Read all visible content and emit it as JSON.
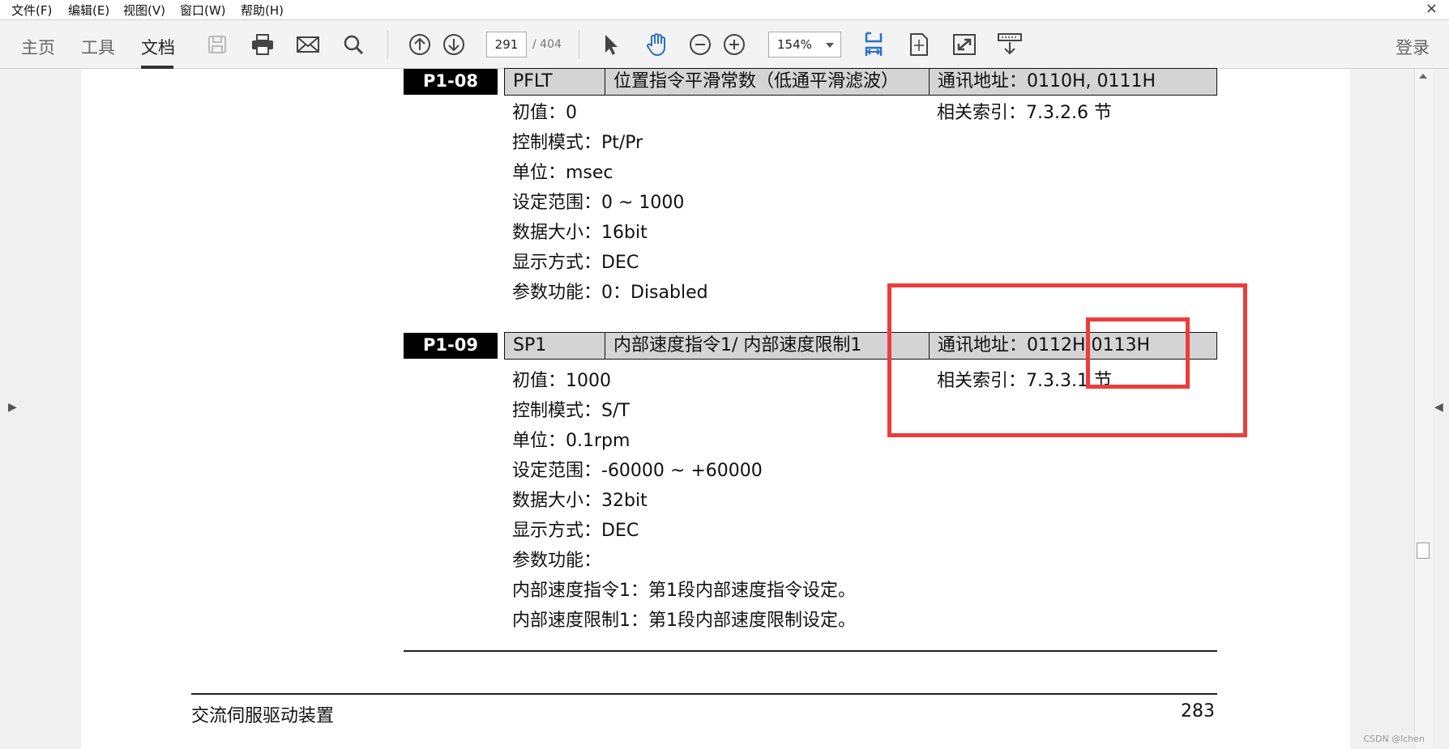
{
  "menu": {
    "items": [
      "文件(F)",
      "编辑(E)",
      "视图(V)",
      "窗口(W)",
      "帮助(H)"
    ],
    "close_glyph": "×"
  },
  "toolbar": {
    "tabs": [
      "主页",
      "工具",
      "文档"
    ],
    "active_tab": "文档",
    "icons": [
      "save-icon",
      "print-icon",
      "mail-icon",
      "search-icon",
      "prev-page-icon",
      "next-page-icon",
      "select-cursor-icon",
      "hand-tool-icon",
      "zoom-out-icon",
      "zoom-in-icon",
      "fit-width-icon",
      "fit-page-icon",
      "fullscreen-icon",
      "read-mode-icon"
    ],
    "page_current": "291",
    "page_total": "/ 404",
    "zoom": "154%",
    "login": "登录"
  },
  "doc": {
    "p1_08": {
      "id": "P1-08",
      "abbr": "PFLT",
      "name": "位置指令平滑常数（低通平滑滤波）",
      "address": "通讯地址：0110H, 0111H",
      "ref": "相关索引：7.3.2.6 节",
      "lines": [
        "初值：0",
        "控制模式：Pt/Pr",
        "单位：msec",
        "设定范围：0 ~ 1000",
        "数据大小：16bit",
        "显示方式：DEC",
        "参数功能：0：Disabled"
      ]
    },
    "p1_09": {
      "id": "P1-09",
      "abbr": "SP1",
      "name": "内部速度指令1/ 内部速度限制1",
      "address": "通讯地址：0112H  0113H",
      "ref": "相关索引：7.3.3.1 节",
      "lines": [
        "初值：1000",
        "控制模式：S/T",
        "单位：0.1rpm",
        "设定范围：-60000 ~ +60000",
        "数据大小：32bit",
        "显示方式：DEC",
        "参数功能：",
        "内部速度指令1：第1段内部速度指令设定。",
        "内部速度限制1：第1段内部速度限制设定。"
      ]
    },
    "footer_title": "交流伺服驱动装置",
    "footer_page": "283",
    "watermark": "CSDN @lchen"
  },
  "colors": {
    "highlight": "#ef3b3b",
    "header_bg": "#d4d4d4",
    "id_bg": "#000000"
  }
}
